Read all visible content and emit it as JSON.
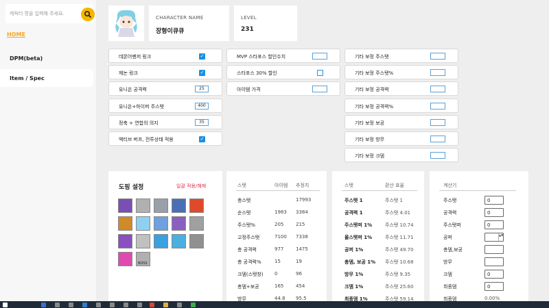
{
  "sidebar": {
    "search_placeholder": "캐릭터 명을 입력해 주세요.",
    "home_label": "HOME",
    "nav": [
      {
        "label": "DPM(beta)",
        "active": false
      },
      {
        "label": "Item / Spec",
        "active": true
      }
    ]
  },
  "character": {
    "name_label": "CHARACTER NAME",
    "name": "장형이큐큐",
    "level_label": "LEVEL",
    "level": "231"
  },
  "options": {
    "col1": [
      {
        "label": "데몬어벤저 링크",
        "type": "check",
        "value": true
      },
      {
        "label": "제논 링크",
        "type": "check",
        "value": true
      },
      {
        "label": "유니온 공격력",
        "type": "number",
        "value": "25"
      },
      {
        "label": "유니온+하이퍼 주스탯",
        "type": "number",
        "value": "400"
      },
      {
        "label": "정축 + 연합의 의지",
        "type": "number",
        "value": "35"
      },
      {
        "label": "액티브 버프, 전투상태 적용",
        "type": "check",
        "value": true
      }
    ],
    "col2": [
      {
        "label": "MVP 스타포스 할인수치",
        "type": "input",
        "value": ""
      },
      {
        "label": "스타포스 30% 할인",
        "type": "check",
        "value": false
      },
      {
        "label": "아이템 가격",
        "type": "input",
        "value": ""
      }
    ],
    "col3": [
      {
        "label": "기타 보정 주스탯",
        "value": ""
      },
      {
        "label": "기타 보정 주스탯%",
        "value": ""
      },
      {
        "label": "기타 보정 공격력",
        "value": ""
      },
      {
        "label": "기타 보정 공격력%",
        "value": ""
      },
      {
        "label": "기타 보정 보공",
        "value": ""
      },
      {
        "label": "기타 보정 방무",
        "value": ""
      },
      {
        "label": "기타 보정 크뎀",
        "value": ""
      }
    ]
  },
  "doping": {
    "title": "도핑 설정",
    "reset": "일괄 적용/해제",
    "boss_label": "BOSS",
    "icons": [
      {
        "name": "doping-icon-1",
        "color": "#7a4fb5"
      },
      {
        "name": "doping-icon-2",
        "color": "#b0b0b0"
      },
      {
        "name": "doping-icon-3",
        "color": "#9aa0a8"
      },
      {
        "name": "doping-icon-4",
        "color": "#4a6fb5"
      },
      {
        "name": "doping-icon-5",
        "color": "#e04a2a"
      },
      {
        "name": "doping-icon-6",
        "color": "#d08a2a"
      },
      {
        "name": "doping-icon-7",
        "color": "#8fd0f0"
      },
      {
        "name": "doping-icon-8",
        "color": "#6fa0e0"
      },
      {
        "name": "doping-icon-9",
        "color": "#8a5fc0"
      },
      {
        "name": "doping-icon-10",
        "color": "#a0a0a0"
      },
      {
        "name": "doping-icon-11",
        "color": "#8a4fc0"
      },
      {
        "name": "doping-icon-12",
        "color": "#c0c0c0"
      },
      {
        "name": "doping-icon-13",
        "color": "#3aa0e0"
      },
      {
        "name": "doping-icon-14",
        "color": "#4ab0e0"
      },
      {
        "name": "doping-icon-15",
        "color": "#909090"
      },
      {
        "name": "doping-icon-16",
        "color": "#e04ab0"
      },
      {
        "name": "boss-icon",
        "color": "#b0b0b0"
      }
    ]
  },
  "stats": {
    "headers": [
      "스탯",
      "아이템",
      "추정치"
    ],
    "rows": [
      [
        "총스탯",
        "",
        "17993"
      ],
      [
        "순스탯",
        "1983",
        "3384"
      ],
      [
        "주스탯%",
        "205",
        "215"
      ],
      [
        "고정주스탯",
        "7100",
        "7338"
      ],
      [
        "총 공격력",
        "977",
        "1475"
      ],
      [
        "총 공격력%",
        "15",
        "19"
      ],
      [
        "크뎀(스탯창)",
        "0",
        "96"
      ],
      [
        "총뎀+보공",
        "165",
        "454"
      ],
      [
        "방무",
        "44.8",
        "95.5"
      ]
    ]
  },
  "conversion": {
    "headers": [
      "스탯",
      "환산 효율"
    ],
    "rows": [
      [
        "주스탯 1",
        "주스탯 1"
      ],
      [
        "공격력 1",
        "주스탯 4.01"
      ],
      [
        "주스탯퍼 1%",
        "주스탯 10.74"
      ],
      [
        "올스탯퍼 1%",
        "주스탯 11.71"
      ],
      [
        "공퍼 1%",
        "주스탯 49.70"
      ],
      [
        "총뎀, 보공 1%",
        "주스탯 10.68"
      ],
      [
        "방무 1%",
        "주스탯 9.35"
      ],
      [
        "크뎀 1%",
        "주스탯 25.60"
      ],
      [
        "최종뎀 1%",
        "주스탯 59.14"
      ]
    ]
  },
  "calculator": {
    "title": "계산기",
    "rows": [
      {
        "label": "주스탯",
        "value": "0",
        "kind": "input"
      },
      {
        "label": "공격력",
        "value": "0",
        "kind": "input"
      },
      {
        "label": "주스탯퍼",
        "value": "0",
        "kind": "input"
      },
      {
        "label": "공퍼",
        "value": "",
        "kind": "spinner"
      },
      {
        "label": "총뎀,보공",
        "value": "",
        "kind": "input"
      },
      {
        "label": "방무",
        "value": "",
        "kind": "input"
      },
      {
        "label": "크뎀",
        "value": "0",
        "kind": "input"
      },
      {
        "label": "최종뎀",
        "value": "0",
        "kind": "input"
      },
      {
        "label": "최종뎀",
        "value": "0.00%",
        "kind": "text"
      }
    ]
  },
  "colors": {
    "accent": "#f5b400",
    "check": "#1a8fe3",
    "reset": "#e03050",
    "taskbar": "#1f2b38"
  }
}
